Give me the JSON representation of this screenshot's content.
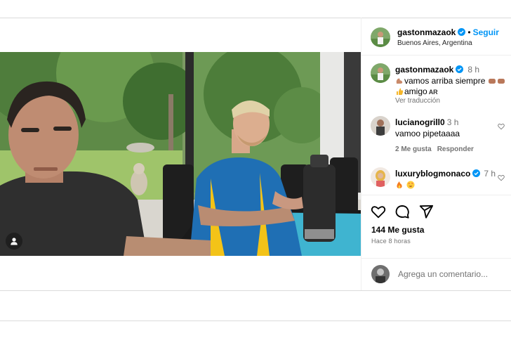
{
  "post": {
    "username": "gastonmazaok",
    "follow_label": "Seguir",
    "location": "Buenos Aires, Argentina",
    "likes": "144 Me gusta",
    "timestamp": "Hace 8 horas",
    "comment_placeholder": "Agrega un comentario..."
  },
  "caption": {
    "username": "gastonmazaok",
    "time": "8 h",
    "line1": "vamos arriba siempre",
    "line2": "amigo",
    "country": "AR",
    "translate_label": "Ver traducción"
  },
  "comments": [
    {
      "username": "lucianogrill0",
      "time": "3 h",
      "text": "vamoo pipetaaaa",
      "likes_label": "2 Me gusta",
      "reply_label": "Responder"
    },
    {
      "username": "luxuryblogmonaco",
      "time": "7 h",
      "text": ""
    }
  ],
  "colors": {
    "accent": "#0095f6",
    "verified": "#0095f6",
    "secondary_text": "#737373",
    "border": "#dbdbdb"
  },
  "icons": {
    "like": "heart-icon",
    "comment": "comment-icon",
    "share": "share-icon",
    "user_tag": "user-tag-icon"
  }
}
